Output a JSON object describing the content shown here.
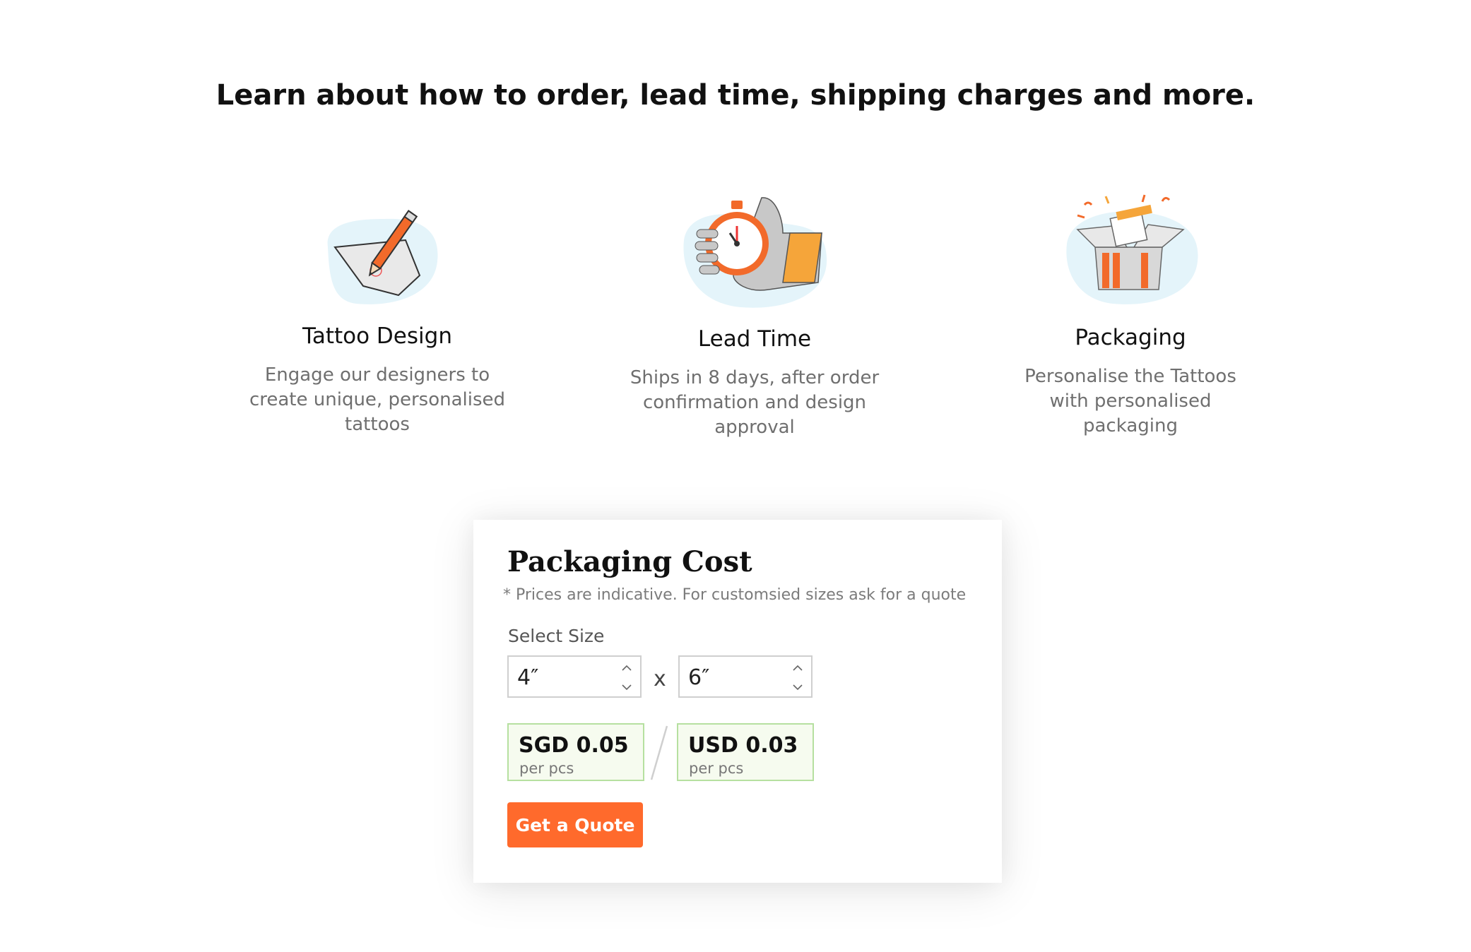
{
  "headline": "Learn about how to order, lead time, shipping charges and more.",
  "features": [
    {
      "icon": "pencil-paper-icon",
      "title": "Tattoo Design",
      "desc_lines": [
        "Engage our designers to",
        "create unique, personalised",
        "tattoos"
      ]
    },
    {
      "icon": "stopwatch-hand-icon",
      "title": "Lead Time",
      "desc_lines": [
        "Ships in 8 days, after order",
        "confirmation and design",
        "approval"
      ]
    },
    {
      "icon": "gift-box-icon",
      "title": "Packaging",
      "desc_lines": [
        "Personalise the Tattoos",
        "with personalised",
        "packaging"
      ]
    }
  ],
  "card": {
    "title": "Packaging Cost",
    "note": "* Prices are indicative. For customsied sizes ask for a quote",
    "select_label": "Select Size",
    "width_value": "4″",
    "height_value": "6″",
    "times": "x",
    "sgd_price": "SGD 0.05",
    "usd_price": "USD 0.03",
    "per_unit": "per pcs",
    "quote_button": "Get a Quote"
  },
  "colors": {
    "accent": "#ff6a2c",
    "price_border": "#b6e0a0",
    "price_bg": "#f6fbef",
    "blob": "#e4f4fa"
  }
}
